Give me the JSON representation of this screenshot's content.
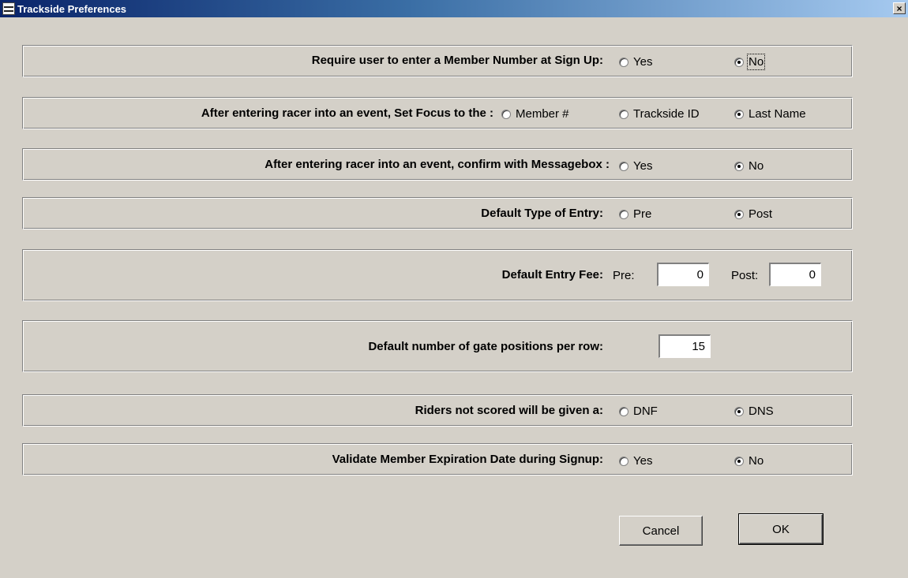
{
  "window": {
    "title": "Trackside Preferences",
    "close_label": "×"
  },
  "settings": {
    "member_number": {
      "label": "Require user to enter a Member Number at Sign Up:",
      "options": [
        "Yes",
        "No"
      ],
      "selected": "No"
    },
    "set_focus": {
      "label": "After entering racer into an event, Set Focus to the :",
      "options": [
        "Member #",
        "Trackside ID",
        "Last Name"
      ],
      "selected": "Last Name"
    },
    "confirm_messagebox": {
      "label": "After entering racer into an event, confirm with Messagebox :",
      "options": [
        "Yes",
        "No"
      ],
      "selected": "No"
    },
    "entry_type": {
      "label": "Default Type of Entry:",
      "options": [
        "Pre",
        "Post"
      ],
      "selected": "Post"
    },
    "entry_fee": {
      "label": "Default Entry Fee:",
      "pre_label": "Pre:",
      "pre_value": "0",
      "post_label": "Post:",
      "post_value": "0"
    },
    "gate_positions": {
      "label": "Default number of gate positions per row:",
      "value": "15"
    },
    "not_scored": {
      "label": "Riders not scored will be given a:",
      "options": [
        "DNF",
        "DNS"
      ],
      "selected": "DNS"
    },
    "expiration": {
      "label": "Validate Member Expiration Date during Signup:",
      "options": [
        "Yes",
        "No"
      ],
      "selected": "No"
    }
  },
  "buttons": {
    "cancel": "Cancel",
    "ok": "OK"
  }
}
